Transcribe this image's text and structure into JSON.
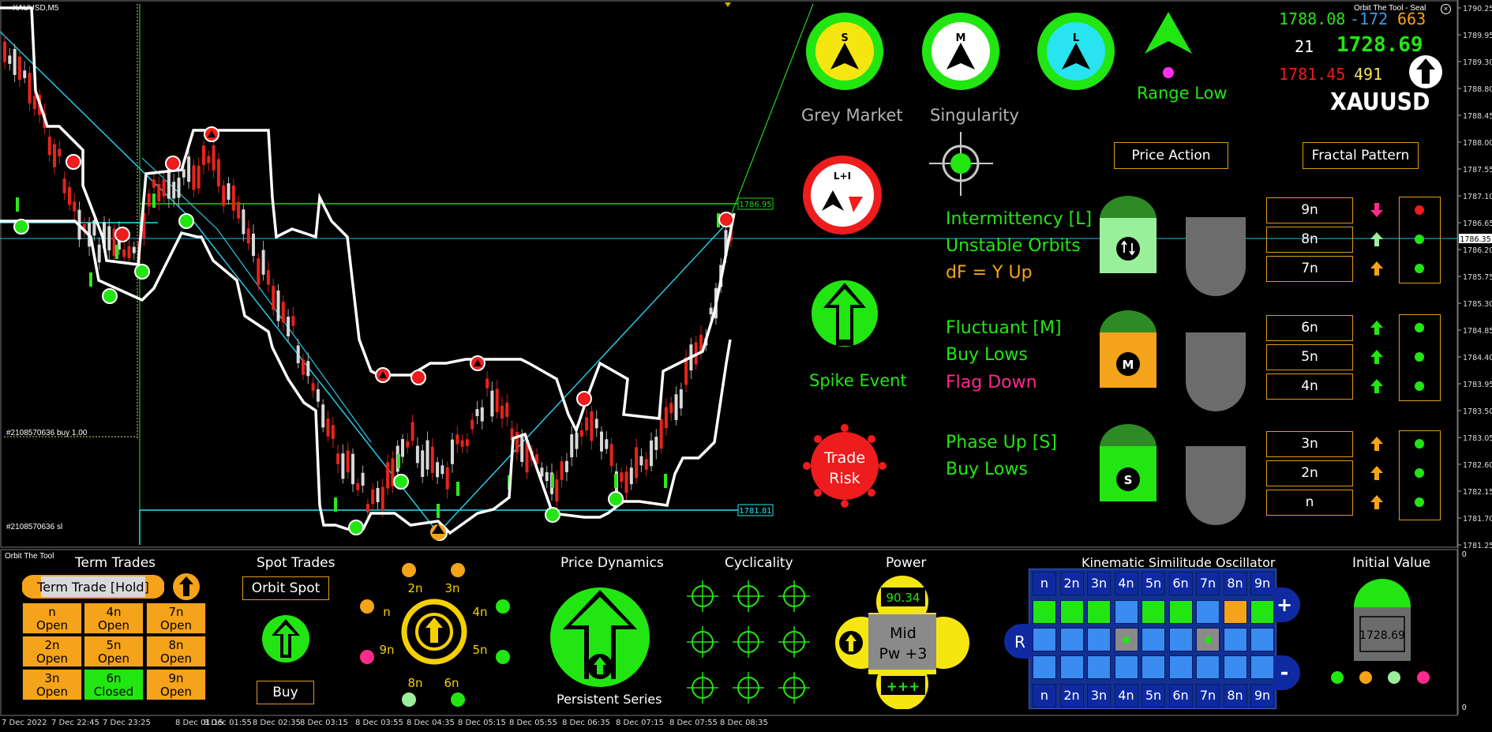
{
  "chart": {
    "symbol": "XAUUSD,M5",
    "indicator_label": "Orbit The Tool - Seal",
    "order_buy_label": "#2108570636 buy 1.00",
    "order_sl_label": "#2108570636 sl",
    "level_high": "1786.95",
    "level_low": "1781.81",
    "current_price_tag": "1786.35",
    "price_axis": [
      "1790.25",
      "1789.95",
      "1789.30",
      "1788.80",
      "1788.45",
      "1788.00",
      "1787.55",
      "1787.10",
      "1786.65",
      "1786.20",
      "1785.75",
      "1785.30",
      "1784.85",
      "1784.40",
      "1783.95",
      "1783.50",
      "1783.05",
      "1782.60",
      "1782.15",
      "1781.70",
      "1781.25"
    ],
    "time_axis": [
      "7 Dec 2022",
      "7 Dec 22:45",
      "7 Dec 23:25",
      "8 Dec 01:15",
      "8 Dec 01:55",
      "8 Dec 02:35",
      "8 Dec 03:15",
      "8 Dec 03:55",
      "8 Dec 04:35",
      "8 Dec 05:15",
      "8 Dec 05:55",
      "8 Dec 06:35",
      "8 Dec 07:15",
      "8 Dec 07:55",
      "8 Dec 08:35"
    ],
    "sub_axis_top": "0",
    "sub_axis_bottom": "0",
    "sub_window_label": "Orbit The Tool"
  },
  "stats": {
    "v1": "1788.08",
    "v2": "-172",
    "v3": "663",
    "v4": "21",
    "v5": "1728.69",
    "v6": "1781.45",
    "v7": "491",
    "symbol_big": "XAUUSD"
  },
  "dials": {
    "s_letter": "S",
    "m_letter": "M",
    "l_letter": "L",
    "li_letter": "L+I",
    "grey_market": "Grey Market",
    "singularity": "Singularity",
    "range_low": "Range Low",
    "spike_event": "Spike Event",
    "trade_risk_1": "Trade",
    "trade_risk_2": "Risk"
  },
  "buttons": {
    "price_action": "Price Action",
    "fractal_pattern": "Fractal Pattern"
  },
  "status": {
    "intermittency": "Intermittency [L]",
    "unstable_orbits": "Unstable Orbits",
    "df_y_up": "dF = Y Up",
    "fluctuant": "Fluctuant [M]",
    "buy_lows_1": "Buy Lows",
    "flag_down": "Flag Down",
    "phase_up": "Phase Up [S]",
    "buy_lows_2": "Buy Lows",
    "m_badge": "M",
    "s_badge": "S"
  },
  "levels": [
    "9n",
    "8n",
    "7n",
    "6n",
    "5n",
    "4n",
    "3n",
    "2n",
    "n"
  ],
  "colors": {
    "green": "#22e612",
    "orange": "#f5a31a",
    "cyan": "#27e4f0",
    "red": "#ee1c1c",
    "magenta": "#ff2a8c",
    "blue": "#1b3bd8"
  },
  "panel": {
    "term_trades_title": "Term Trades",
    "term_trade_hold": "Term Trade [Hold]",
    "grid": [
      [
        "n",
        "Open"
      ],
      [
        "4n",
        "Open"
      ],
      [
        "7n",
        "Open"
      ],
      [
        "2n",
        "Open"
      ],
      [
        "5n",
        "Open"
      ],
      [
        "8n",
        "Open"
      ],
      [
        "3n",
        "Open"
      ],
      [
        "6n",
        "Closed"
      ],
      [
        "9n",
        "Open"
      ]
    ],
    "spot_trades_title": "Spot Trades",
    "orbit_spot": "Orbit Spot",
    "buy": "Buy",
    "ring_labels": [
      "2n",
      "3n",
      "4n",
      "5n",
      "6n",
      "8n",
      "9n",
      "n"
    ],
    "price_dynamics_title": "Price Dynamics",
    "persistent_series": "Persistent Series",
    "cyclicality_title": "Cyclicality",
    "power_title": "Power",
    "power_value": "90.34",
    "power_mid": "Mid",
    "power_pw": "Pw +3",
    "power_plus": "+++",
    "kso_title": "Kinematic Similitude Oscillator",
    "kso_header": [
      "n",
      "2n",
      "3n",
      "4n",
      "5n",
      "6n",
      "7n",
      "8n",
      "9n"
    ],
    "kso_plus": "+",
    "kso_minus": "-",
    "kso_r": "R",
    "initial_value_title": "Initial Value",
    "initial_value": "1728.69"
  }
}
